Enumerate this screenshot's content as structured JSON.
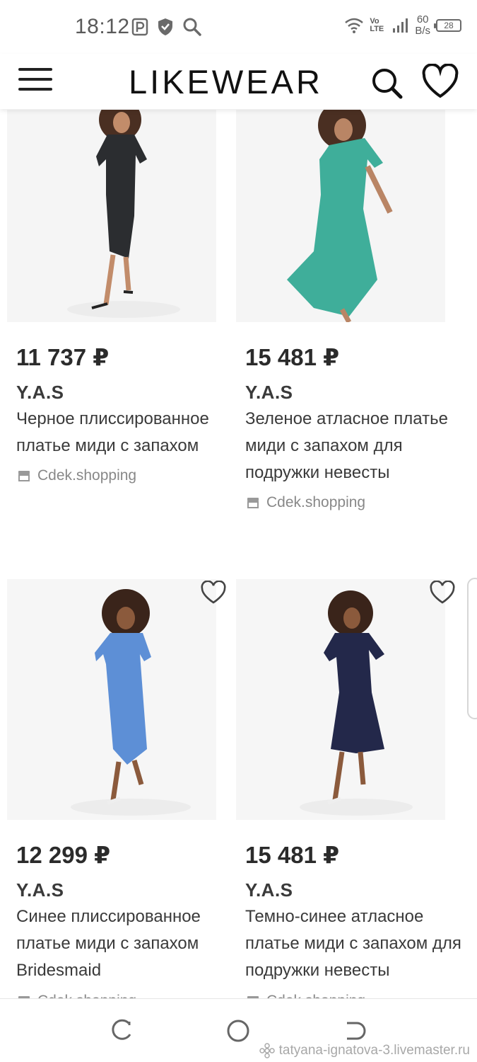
{
  "status_bar": {
    "time": "18:12",
    "network_speed_value": "60",
    "network_speed_unit": "B/s",
    "network_type": "Vo LTE",
    "battery_level": "28",
    "icons": [
      "parking-icon",
      "shield-icon",
      "search-icon",
      "wifi-icon",
      "signal-icon",
      "battery-icon"
    ]
  },
  "header": {
    "logo": "LIKEWEAR",
    "icons": [
      "menu-icon",
      "search-icon",
      "heart-icon"
    ]
  },
  "products": [
    {
      "price": "11 737 ₽",
      "brand": "Y.A.S",
      "title": "Черное плиссированное платье миди с запахом",
      "shop": "Cdek.shopping",
      "dress_color": "#2b2d30"
    },
    {
      "price": "15 481 ₽",
      "brand": "Y.A.S",
      "title": "Зеленое атласное платье миди с запахом для подружки невесты",
      "shop": "Cdek.shopping",
      "dress_color": "#3fae9a"
    },
    {
      "price": "12 299 ₽",
      "brand": "Y.A.S",
      "title": "Синее плиссированное платье миди с запахом Bridesmaid",
      "shop": "Cdek.shopping",
      "dress_color": "#5d8fd6"
    },
    {
      "price": "15 481 ₽",
      "brand": "Y.A.S",
      "title": "Темно-синее атласное платье миди с запахом для подружки невесты",
      "shop": "Cdek.shopping",
      "dress_color": "#23284a"
    }
  ],
  "nav_bar": {
    "buttons": [
      "recents-button",
      "home-button",
      "back-button"
    ]
  },
  "watermark": "tatyana-ignatova-3.livemaster.ru"
}
